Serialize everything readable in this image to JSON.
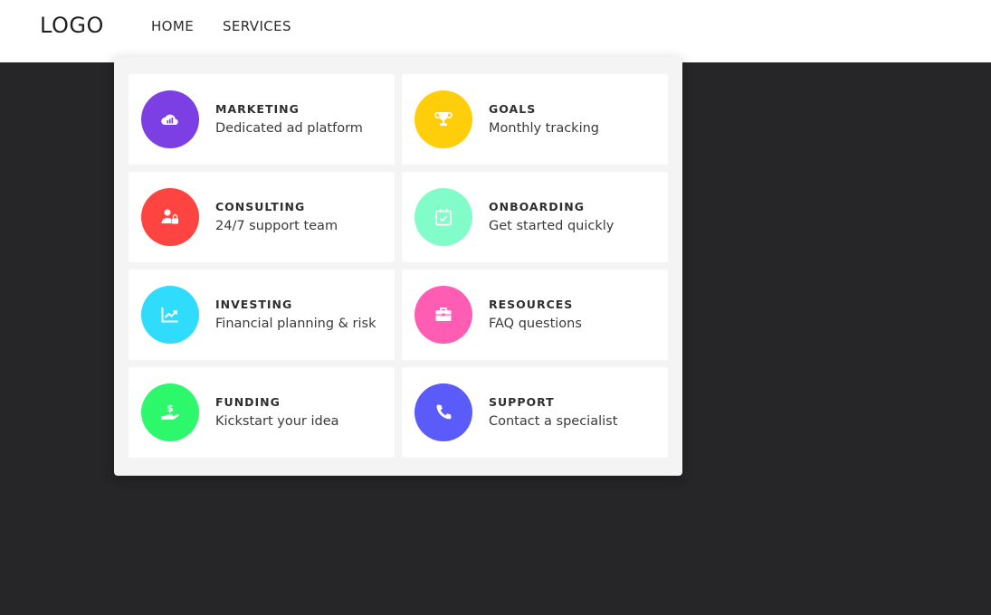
{
  "nav": {
    "logo": "LOGO",
    "links": [
      "HOME",
      "SERVICES"
    ]
  },
  "dropdown": {
    "items": [
      {
        "title": "MARKETING",
        "desc": "Dedicated ad platform",
        "icon": "cloud-chart-icon",
        "color": "#7b3fe4"
      },
      {
        "title": "GOALS",
        "desc": "Monthly tracking",
        "icon": "trophy-icon",
        "color": "#ffce0a"
      },
      {
        "title": "CONSULTING",
        "desc": "24/7 support team",
        "icon": "user-lock-icon",
        "color": "#fd4440"
      },
      {
        "title": "ONBOARDING",
        "desc": "Get started quickly",
        "icon": "calendar-check-icon",
        "color": "#82fcc8"
      },
      {
        "title": "INVESTING",
        "desc": "Financial planning & risk",
        "icon": "chart-line-icon",
        "color": "#2fdcfc"
      },
      {
        "title": "RESOURCES",
        "desc": "FAQ questions",
        "icon": "briefcase-icon",
        "color": "#ff5db4"
      },
      {
        "title": "FUNDING",
        "desc": "Kickstart your idea",
        "icon": "hand-dollar-icon",
        "color": "#2df86c"
      },
      {
        "title": "SUPPORT",
        "desc": "Contact a specialist",
        "icon": "phone-icon",
        "color": "#5a5bf8"
      }
    ]
  }
}
